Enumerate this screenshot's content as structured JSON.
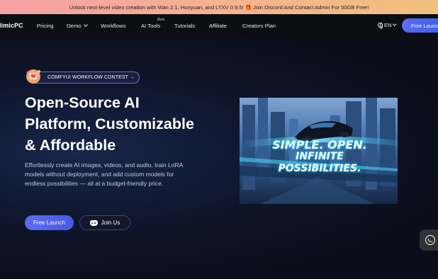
{
  "banner": {
    "text_before": "Unlock next-level video creation with Wan 2.1, Hunyuan, and LTXV 0.9.5!",
    "gift_icon": "🎁",
    "text_after": "Join Discord And Contact Admin For 50GB Free!",
    "gradient": [
      "#f5a0a5",
      "#f0c07c"
    ]
  },
  "nav": {
    "logo": "MimicPC",
    "items": {
      "pricing": "Pricing",
      "demo": "Demo",
      "workflows": "Workflows",
      "ai_tools": "AI Tools",
      "ai_tools_badge": "Beta",
      "tutorials": "Tutorials",
      "affiliate": "Affiliate",
      "creators_plan": "Creators Plan"
    },
    "language": "EN",
    "launch": "Free Launch"
  },
  "hero": {
    "contest_label": "COMFYUI WORKFLOW CONTEST →",
    "title_lines": [
      "Open-Source AI",
      "Platform, Customizable",
      "& Affordable"
    ],
    "description": "Effortlessly create AI images, videos, and audio, train LoRA models without deployment, and add custom models for endless possibilities — all at a budget-friendly price.",
    "primary_button": "Free Launch",
    "secondary_button": "Join Us",
    "media_text_line1": "SIMPLE. OPEN.",
    "media_text_line2": "INFINITE POSSIBILITIES."
  },
  "colors": {
    "accent": "#5b6df5",
    "background": "#0b0c14",
    "hero_glow": "#17264a"
  },
  "icons": {
    "contest": "trophy-icon",
    "demo_dropdown": "chevron-down-icon",
    "language": "globe-icon",
    "join": "discord-icon",
    "floating": "whatsapp-icon"
  }
}
